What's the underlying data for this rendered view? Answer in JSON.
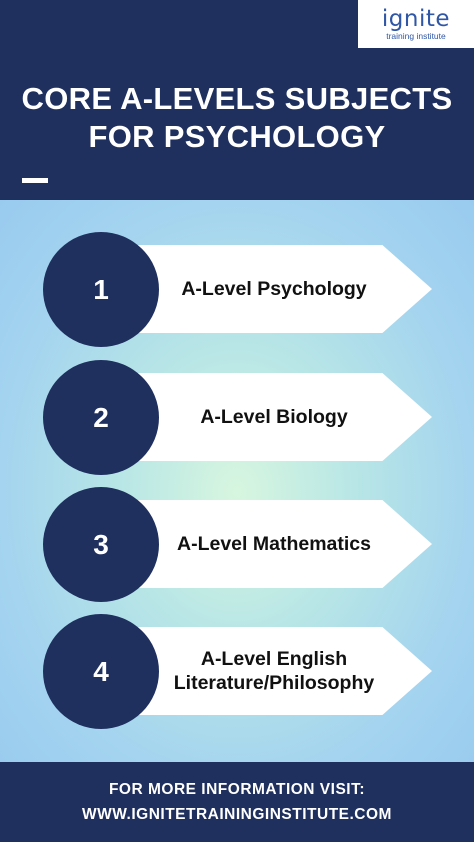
{
  "logo": {
    "wordmark": "ignite",
    "tagline": "training institute"
  },
  "header": {
    "title_line1": "CORE A-LEVELS SUBJECTS",
    "title_line2": "FOR PSYCHOLOGY"
  },
  "subjects": [
    {
      "number": "1",
      "label": "A-Level Psychology"
    },
    {
      "number": "2",
      "label": "A-Level Biology"
    },
    {
      "number": "3",
      "label": "A-Level Mathematics"
    },
    {
      "number": "4",
      "label_line1": "A-Level English",
      "label_line2": "Literature/Philosophy"
    }
  ],
  "footer": {
    "line1": "FOR MORE INFORMATION VISIT:",
    "line2": "WWW.IGNITETRAININGINSTITUTE.COM"
  },
  "colors": {
    "navy": "#1f2f5e",
    "white": "#ffffff",
    "logo_blue": "#2f57a6"
  }
}
